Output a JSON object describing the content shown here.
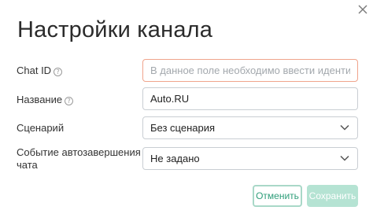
{
  "dialog": {
    "title": "Настройки канала",
    "close_icon": "close-icon"
  },
  "fields": {
    "chat_id": {
      "label": "Chat ID",
      "help_glyph": "?",
      "value": "",
      "placeholder": "В данное поле необходимо ввести идентификат…",
      "error": true,
      "error_color": "#f0a48c"
    },
    "name": {
      "label": "Название",
      "help_glyph": "?",
      "value": "Auto.RU"
    },
    "scenario": {
      "label": "Сценарий",
      "value": "Без сценария"
    },
    "autoclose_event": {
      "label_line1": "Событие автозавершения",
      "label_line2": "чата",
      "value": "Не задано"
    }
  },
  "actions": {
    "cancel_label": "Отменить",
    "save_label": "Сохранить",
    "accent_color": "#2f9e7a",
    "save_disabled": true
  }
}
